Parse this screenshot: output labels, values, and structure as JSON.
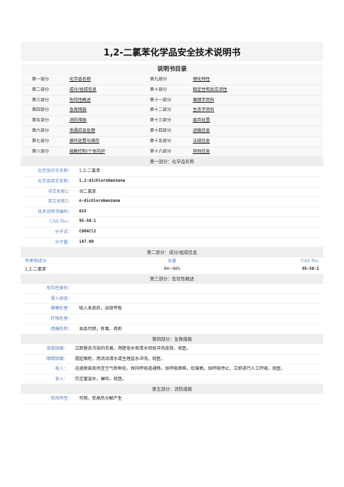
{
  "title": "1,2-二氯苯化学品安全技术说明书",
  "toc": {
    "heading": "说明书目录",
    "items": [
      {
        "num": "第一部分",
        "label": "化学品名称",
        "num2": "第九部分",
        "label2": "理化特性"
      },
      {
        "num": "第二部分",
        "label": "成分/组成信息",
        "num2": "第十部分",
        "label2": "稳定性和反应活性"
      },
      {
        "num": "第三部分",
        "label": "危险性概述",
        "num2": "第十一部分",
        "label2": "毒理学资料"
      },
      {
        "num": "第四部分",
        "label": "急救措施",
        "num2": "第十二部分",
        "label2": "生态学资料"
      },
      {
        "num": "第五部分",
        "label": "消防措施",
        "num2": "第十三部分",
        "label2": "废弃处置"
      },
      {
        "num": "第六部分",
        "label": "泄漏应急处理",
        "num2": "第十四部分",
        "label2": "运输信息"
      },
      {
        "num": "第七部分",
        "label": "操作处置与储存",
        "num2": "第十五部分",
        "label2": "法规信息"
      },
      {
        "num": "第八部分",
        "label": "接触控制/个体防护",
        "num2": "第十六部分",
        "label2": "其他信息"
      }
    ]
  },
  "s1": {
    "header": "第一部分：化学品名称",
    "rows": [
      {
        "label": "化学品中文名称：",
        "value": "1,2-二氯苯"
      },
      {
        "label": "化学品英文名称：",
        "value": "1,2-dichlorobenzene"
      },
      {
        "label": "中文名称2：",
        "value": "邻二氯苯"
      },
      {
        "label": "英文名称2：",
        "value": "o-dichlorobenzene"
      },
      {
        "label": "技术说明书编码：",
        "value": "622"
      },
      {
        "label": "CAS No.：",
        "value": "95-50-1"
      },
      {
        "label": "分子式：",
        "value": "C6H4Cl2"
      },
      {
        "label": "分子量：",
        "value": "147.00"
      }
    ]
  },
  "s2": {
    "header": "第二部分：成分/组成信息",
    "col1": "有害物成分",
    "col2": "含量",
    "col3": "CAS No.",
    "v1": "1,2-二氯苯",
    "v2": "84～86%",
    "v3": "95-50-1"
  },
  "s3": {
    "header": "第三部分：危险性概述",
    "rows": [
      {
        "label": "危险性类别：",
        "value": ""
      },
      {
        "label": "侵入途径：",
        "value": ""
      },
      {
        "label": "健康危害：",
        "value": "吸入本品后，出现呼吸"
      },
      {
        "label": "环境危害：",
        "value": ""
      },
      {
        "label": "燃爆危险：",
        "value": "本品可燃，有毒，具刺"
      }
    ]
  },
  "s4": {
    "header": "第四部分：急救措施",
    "rows": [
      {
        "label": "皮肤接触：",
        "value": "立即脱去污染的衣着，用肥皂水和清水彻底冲洗皮肤。就医。"
      },
      {
        "label": "眼睛接触：",
        "value": "提起眼睑，用流动清水或生理盐水冲洗。就医。"
      },
      {
        "label": "吸入：",
        "value": "迅速脱离现场至空气新鲜处。保持呼吸道通畅。如呼吸困难，给输氧。如呼吸停止，立即进行人工呼吸。就医。"
      },
      {
        "label": "食入：",
        "value": "饮足量温水，催吐。就医。"
      }
    ]
  },
  "s5": {
    "header": "第五部分：消防措施",
    "rows": [
      {
        "label": "危险特性：",
        "value": "可燃。受高热分解产生"
      }
    ]
  }
}
